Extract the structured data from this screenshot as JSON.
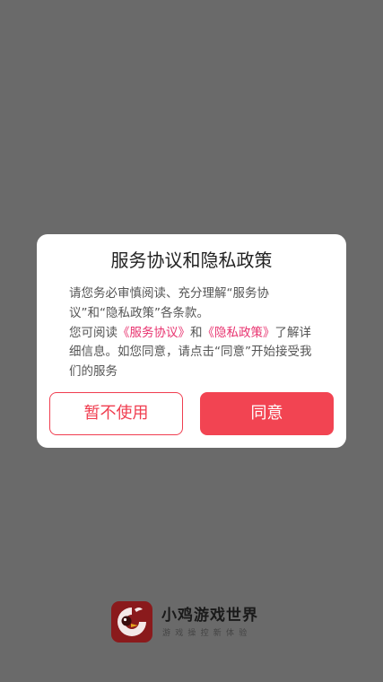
{
  "dialog": {
    "title": "服务协议和隐私政策",
    "paragraph1": "请您务必审慎阅读、充分理解“服务协议”和“隐私政策”各条款。",
    "paragraph2_prefix": "您可阅读",
    "service_agreement_link": "《服务协议》",
    "paragraph2_and": "和",
    "privacy_policy_link": "《隐私政策》",
    "paragraph2_suffix": "了解详细信息。如您同意，请点击“同意”开始接受我们的服务",
    "decline_label": "暂不使用",
    "agree_label": "同意"
  },
  "brand": {
    "name": "小鸡游戏世界",
    "tagline": "游戏操控新体验",
    "logo_icon": "chicken-logo-icon",
    "accent_color": "#f24452",
    "link_color": "#e8336f"
  }
}
